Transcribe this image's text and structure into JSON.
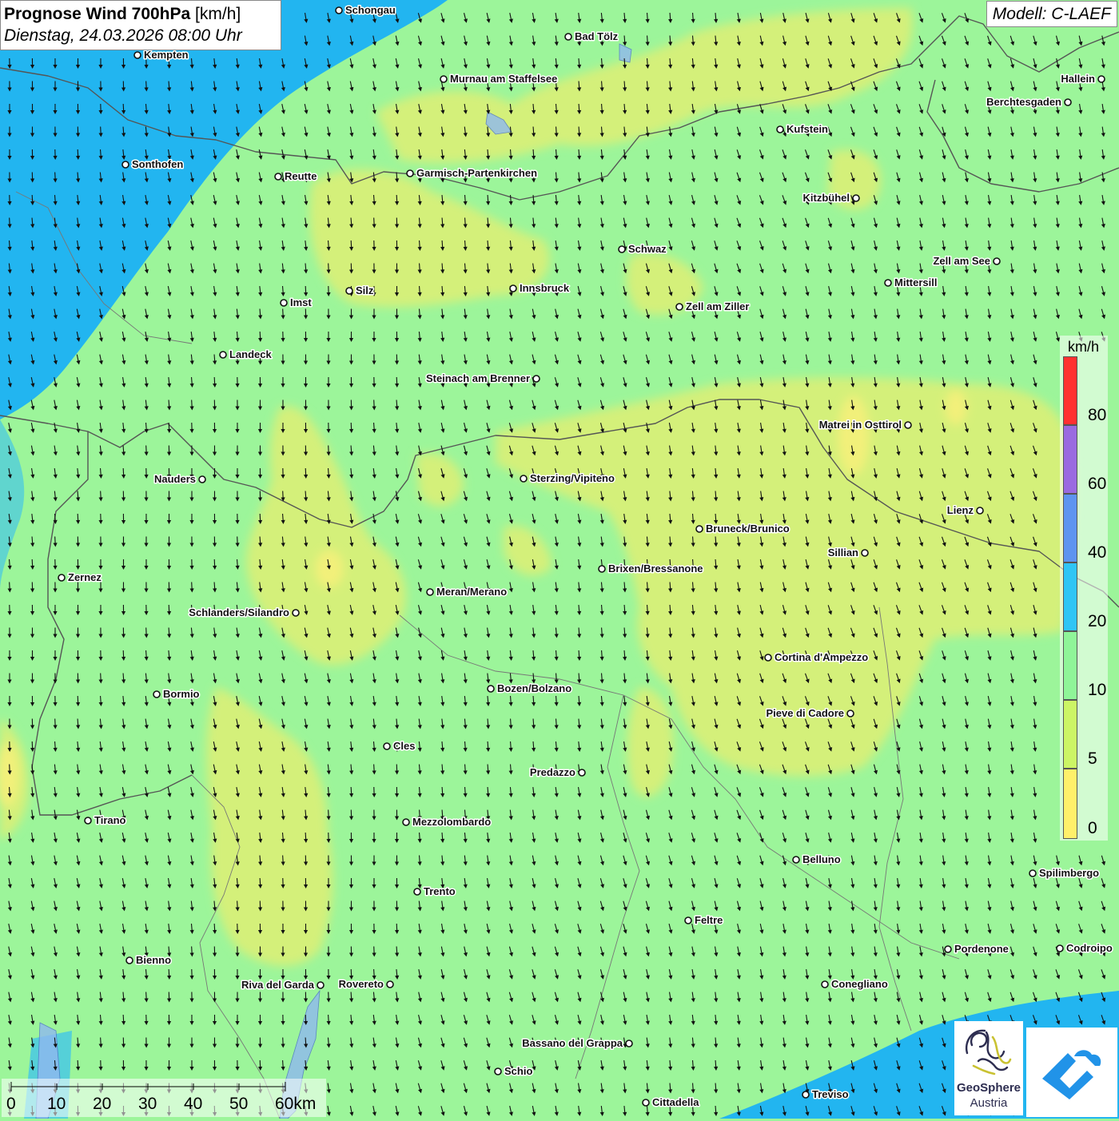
{
  "header": {
    "title": "Prognose Wind 700hPa",
    "unit": "[km/h]",
    "datetime": "Dienstag, 24.03.2026 08:00 Uhr"
  },
  "model_label": "Modell: C-LAEF",
  "legend": {
    "unit": "km/h",
    "ticks": [
      "80",
      "60",
      "40",
      "20",
      "10",
      "5",
      "0"
    ],
    "colors": [
      "#ff3030",
      "#9a6ae0",
      "#5e94f0",
      "#2fc5f5",
      "#8ff598",
      "#ccf565",
      "#fff06a"
    ]
  },
  "scale_bar": {
    "labels": [
      "0",
      "10",
      "20",
      "30",
      "40",
      "50",
      "60km"
    ]
  },
  "logos": {
    "geosphere_line1": "GeoSphere",
    "geosphere_line2": "Austria"
  },
  "colors": {
    "background_green": "#9cf59a",
    "yellow_green": "#d4f07a",
    "blue_wind": "#22b5f0",
    "arrow": "#111111"
  },
  "cities": [
    {
      "name": "Schongau"
    },
    {
      "name": "Bad Tölz"
    },
    {
      "name": "Kempten"
    },
    {
      "name": "Murnau am Staffelsee"
    },
    {
      "name": "Hallein"
    },
    {
      "name": "Berchtesgaden"
    },
    {
      "name": "Kufstein"
    },
    {
      "name": "Sonthofen"
    },
    {
      "name": "Reutte"
    },
    {
      "name": "Garmisch-Partenkirchen"
    },
    {
      "name": "Kitzbühel"
    },
    {
      "name": "Schwaz"
    },
    {
      "name": "Zell am See"
    },
    {
      "name": "Mittersill"
    },
    {
      "name": "Innsbruck"
    },
    {
      "name": "Silz"
    },
    {
      "name": "Imst"
    },
    {
      "name": "Zell am Ziller"
    },
    {
      "name": "Landeck"
    },
    {
      "name": "Steinach am Brenner"
    },
    {
      "name": "Matrei in Osttirol"
    },
    {
      "name": "Nauders"
    },
    {
      "name": "Sterzing/Vipiteno"
    },
    {
      "name": "Lienz"
    },
    {
      "name": "Bruneck/Brunico"
    },
    {
      "name": "Sillian"
    },
    {
      "name": "Brixen/Bressanone"
    },
    {
      "name": "Zernez"
    },
    {
      "name": "Meran/Merano"
    },
    {
      "name": "Schlanders/Silandro"
    },
    {
      "name": "Cortina d'Ampezzo"
    },
    {
      "name": "Bozen/Bolzano"
    },
    {
      "name": "Bormio"
    },
    {
      "name": "Pieve di Cadore"
    },
    {
      "name": "Cles"
    },
    {
      "name": "Predazzo"
    },
    {
      "name": "Tirano"
    },
    {
      "name": "Mezzolombardo"
    },
    {
      "name": "Belluno"
    },
    {
      "name": "Spilimbergo"
    },
    {
      "name": "Trento"
    },
    {
      "name": "Feltre"
    },
    {
      "name": "Bienno"
    },
    {
      "name": "Pordenone"
    },
    {
      "name": "Codroipo"
    },
    {
      "name": "Riva del Garda"
    },
    {
      "name": "Rovereto"
    },
    {
      "name": "Conegliano"
    },
    {
      "name": "Bassano del Grappa"
    },
    {
      "name": "Schio"
    },
    {
      "name": "Treviso"
    },
    {
      "name": "Cittadella"
    }
  ]
}
